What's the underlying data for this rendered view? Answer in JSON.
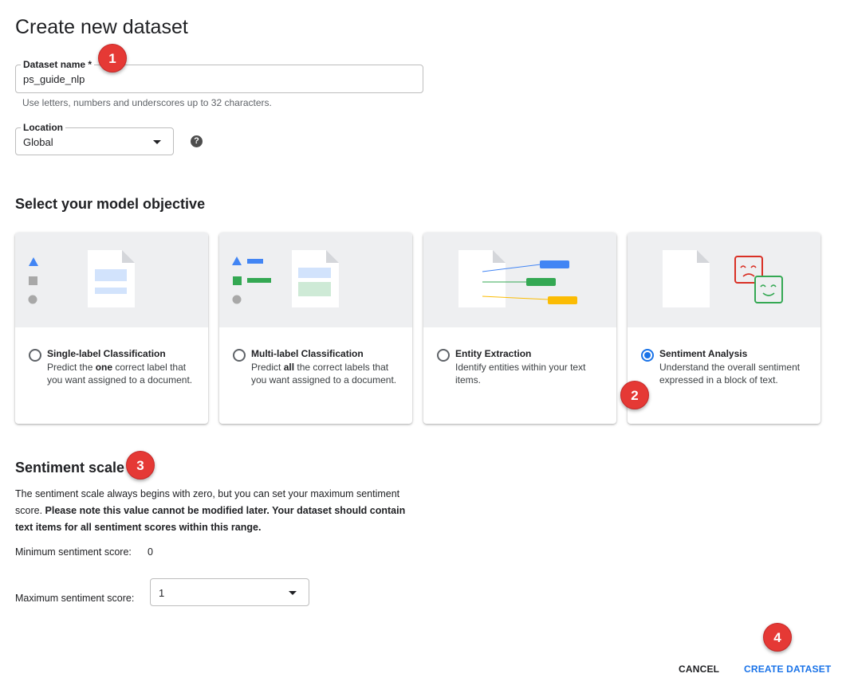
{
  "page": {
    "title": "Create new dataset"
  },
  "dataset_name": {
    "label": "Dataset name *",
    "value": "ps_guide_nlp",
    "hint": "Use letters, numbers and underscores up to 32 characters."
  },
  "location": {
    "label": "Location",
    "value": "Global",
    "help_icon": "question-mark"
  },
  "objective": {
    "title": "Select your model objective",
    "cards": [
      {
        "title": "Single-label Classification",
        "desc_pre": "Predict the ",
        "desc_bold": "one",
        "desc_post": " correct label that you want assigned to a document.",
        "selected": false
      },
      {
        "title": "Multi-label Classification",
        "desc_pre": "Predict ",
        "desc_bold": "all",
        "desc_post": " the correct labels that you want assigned to a document.",
        "selected": false
      },
      {
        "title": "Entity Extraction",
        "desc_pre": "Identify entities within your text items.",
        "desc_bold": "",
        "desc_post": "",
        "selected": false
      },
      {
        "title": "Sentiment Analysis",
        "desc_pre": "Understand the overall sentiment expressed in a block of text.",
        "desc_bold": "",
        "desc_post": "",
        "selected": true
      }
    ]
  },
  "sentiment_scale": {
    "title": "Sentiment scale",
    "desc_normal": "The sentiment scale always begins with zero, but you can set your maximum sentiment score. ",
    "desc_bold": "Please note this value cannot be modified later. Your dataset should contain text items for all sentiment scores within this range.",
    "min_label": "Minimum sentiment score:",
    "min_value": "0",
    "max_label": "Maximum sentiment score:",
    "max_value": "1"
  },
  "actions": {
    "cancel": "CANCEL",
    "create": "CREATE DATASET"
  },
  "steps": [
    "1",
    "2",
    "3",
    "4"
  ],
  "colors": {
    "accent": "#1a73e8",
    "marker": "#e53935",
    "green": "#34a853",
    "yellow": "#fbbc04",
    "red": "#d93025"
  }
}
